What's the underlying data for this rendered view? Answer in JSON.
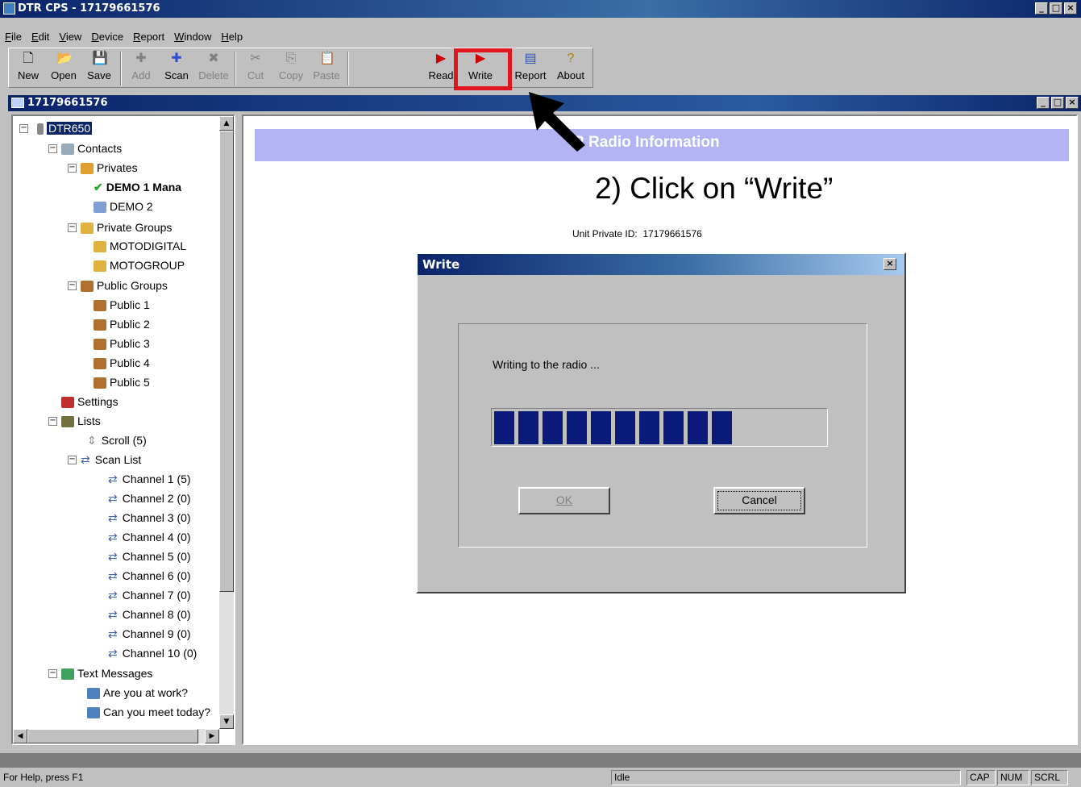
{
  "app": {
    "title": "DTR CPS - 17179661576"
  },
  "menu": [
    "File",
    "Edit",
    "View",
    "Device",
    "Report",
    "Window",
    "Help"
  ],
  "toolbar": {
    "new": "New",
    "open": "Open",
    "save": "Save",
    "add": "Add",
    "scan": "Scan",
    "delete": "Delete",
    "cut": "Cut",
    "copy": "Copy",
    "paste": "Paste",
    "read": "Read",
    "write": "Write",
    "report": "Report",
    "about": "About"
  },
  "mdi": {
    "title": "17179661576"
  },
  "tree": {
    "root": "DTR650",
    "contacts": "Contacts",
    "privates": "Privates",
    "demo1": "DEMO 1 Mana",
    "demo2": "DEMO 2",
    "private_groups": "Private Groups",
    "motodigital": "MOTODIGITAL",
    "motogroup": "MOTOGROUP",
    "public_groups": "Public Groups",
    "public": [
      "Public 1",
      "Public 2",
      "Public 3",
      "Public 4",
      "Public 5"
    ],
    "settings": "Settings",
    "lists": "Lists",
    "scroll": "Scroll (5)",
    "scan_list": "Scan List",
    "channels": [
      "Channel 1 (5)",
      "Channel 2 (0)",
      "Channel 3 (0)",
      "Channel 4 (0)",
      "Channel 5 (0)",
      "Channel 6 (0)",
      "Channel 7 (0)",
      "Channel 8 (0)",
      "Channel 9 (0)",
      "Channel 10 (0)"
    ],
    "text_messages": "Text Messages",
    "msgs": [
      "Are you at work?",
      "Can you meet today?"
    ]
  },
  "main": {
    "info_header": "R Radio Information",
    "instruction": "2) Click on “Write”",
    "unit_id_label": "Unit Private ID:",
    "unit_id_value": "17179661576"
  },
  "dialog": {
    "title": "Write",
    "message": "Writing to the radio ...",
    "progress": 0.8,
    "ok": "OK",
    "cancel": "Cancel"
  },
  "status": {
    "help": "For Help, press F1",
    "state": "Idle",
    "cap": "CAP",
    "num": "NUM",
    "scrl": "SCRL"
  },
  "colors": {
    "highlight": "#e0151d",
    "title_blue": "#0a246a",
    "info_bar": "#b4b4f5",
    "progress": "#0a1a7a"
  }
}
